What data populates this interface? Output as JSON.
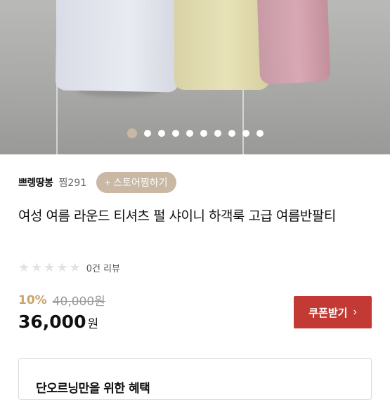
{
  "store": {
    "name": "쁘렝땅봉",
    "zzim_label": "찜291",
    "follow_label": "+ 스토어찜하기"
  },
  "product": {
    "title": "여성 여름 라운드 티셔츠 펄 샤이니 하객룩 고급 여름반팔티",
    "rating": 0,
    "max_rating": 5,
    "review_text": "0건 리뷰",
    "discount": "10%",
    "original_price": "40,000원",
    "price": "36,000",
    "price_unit": "원"
  },
  "coupon_button": {
    "label": "쿠폰받기",
    "icon": "chevron-right-icon"
  },
  "carousel": {
    "total": 10,
    "active_index": 0
  },
  "benefit": {
    "title": "단오르닝만을 위한 혜택"
  },
  "colors": {
    "accent": "#c9b8a3",
    "coupon": "#c23a33",
    "discount": "#c9a36b"
  }
}
